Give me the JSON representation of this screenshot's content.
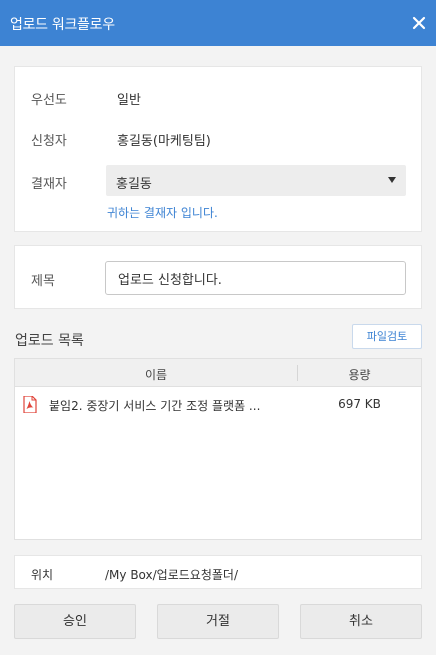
{
  "window": {
    "title": "업로드 워크플로우",
    "close_icon": "close-icon"
  },
  "info": {
    "priority_label": "우선도",
    "priority_value": "일반",
    "applicant_label": "신청자",
    "applicant_value": "홍길동(마케팅팀)",
    "approver_label": "결재자",
    "approver_selected": "홍길동",
    "approver_hint": "귀하는 결재자 입니다."
  },
  "subject": {
    "label": "제목",
    "value": "업로드 신청합니다."
  },
  "upload_list": {
    "title": "업로드 목록",
    "preview_button": "파일검토",
    "columns": {
      "name": "이름",
      "size": "용량"
    },
    "files": [
      {
        "icon": "pdf-icon",
        "name": "붙임2. 중장기 서비스 기간 조정 플랫폼 ...",
        "size": "697 KB"
      }
    ]
  },
  "location": {
    "label": "위치",
    "value": "/My Box/업로드요청폴더/"
  },
  "buttons": {
    "approve": "승인",
    "reject": "거절",
    "cancel": "취소"
  },
  "colors": {
    "accent": "#3d83d3",
    "pdf": "#e0443a"
  }
}
